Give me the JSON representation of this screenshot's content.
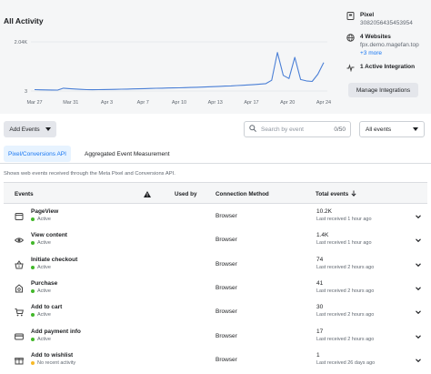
{
  "activity": {
    "title": "All Activity"
  },
  "chart_data": {
    "type": "line",
    "y_ticks": [
      "2.04K",
      "3"
    ],
    "x_ticks": [
      "Mar 27",
      "Mar 31",
      "Apr 3",
      "Apr 7",
      "Apr 10",
      "Apr 13",
      "Apr 17",
      "Apr 20",
      "Apr 24"
    ],
    "ylim": [
      3,
      2040
    ],
    "series": [
      {
        "color": "#4a7fd6",
        "values": [
          60,
          52,
          48,
          45,
          40,
          120,
          100,
          85,
          72,
          60,
          55,
          60,
          62,
          68,
          72,
          78,
          82,
          90,
          95,
          100,
          108,
          115,
          120,
          126,
          130,
          136,
          142,
          150,
          158,
          166,
          175,
          185,
          195,
          205,
          215,
          228,
          240,
          255,
          270,
          290,
          310,
          450,
          1600,
          650,
          520,
          1400,
          480,
          420,
          400,
          700,
          1180
        ]
      }
    ],
    "grid": true,
    "legend": "none"
  },
  "info": {
    "pixel_label": "Pixel",
    "pixel_id": "3082056435453954",
    "websites_label": "4 Websites",
    "website_url": "fpx.demo.magefan.top",
    "website_more": "+3 more",
    "integration_label": "1 Active Integration",
    "manage_button": "Manage Integrations"
  },
  "toolbar": {
    "add_events": "Add Events",
    "search_placeholder": "Search by event",
    "search_count": "0/50",
    "filter_selected": "All events"
  },
  "tabs": [
    {
      "label": "Pixel/Conversions API"
    },
    {
      "label": "Aggregated Event Measurement"
    }
  ],
  "description": "Shows web events received through the Meta Pixel and Conversions API.",
  "table": {
    "headers": {
      "events": "Events",
      "used_by": "Used by",
      "connection": "Connection Method",
      "total": "Total events"
    },
    "rows": [
      {
        "icon": "page-view-icon",
        "name": "PageView",
        "status": "Active",
        "status_color": "#42b72a",
        "method": "Browser",
        "total": "10.2K",
        "received": "Last received 1 hour ago"
      },
      {
        "icon": "eye-icon",
        "name": "View content",
        "status": "Active",
        "status_color": "#42b72a",
        "method": "Browser",
        "total": "1.4K",
        "received": "Last received 1 hour ago"
      },
      {
        "icon": "basket-icon",
        "name": "Initiate checkout",
        "status": "Active",
        "status_color": "#42b72a",
        "method": "Browser",
        "total": "74",
        "received": "Last received 2 hours ago"
      },
      {
        "icon": "shopping-bag-icon",
        "name": "Purchase",
        "status": "Active",
        "status_color": "#42b72a",
        "method": "Browser",
        "total": "41",
        "received": "Last received 2 hours ago"
      },
      {
        "icon": "cart-icon",
        "name": "Add to cart",
        "status": "Active",
        "status_color": "#42b72a",
        "method": "Browser",
        "total": "30",
        "received": "Last received 2 hours ago"
      },
      {
        "icon": "payment-card-icon",
        "name": "Add payment info",
        "status": "Active",
        "status_color": "#42b72a",
        "method": "Browser",
        "total": "17",
        "received": "Last received 2 hours ago"
      },
      {
        "icon": "gift-icon",
        "name": "Add to wishlist",
        "status": "No recent activity",
        "status_color": "#f7b928",
        "method": "Browser",
        "total": "1",
        "received": "Last received 26 days ago"
      }
    ]
  }
}
